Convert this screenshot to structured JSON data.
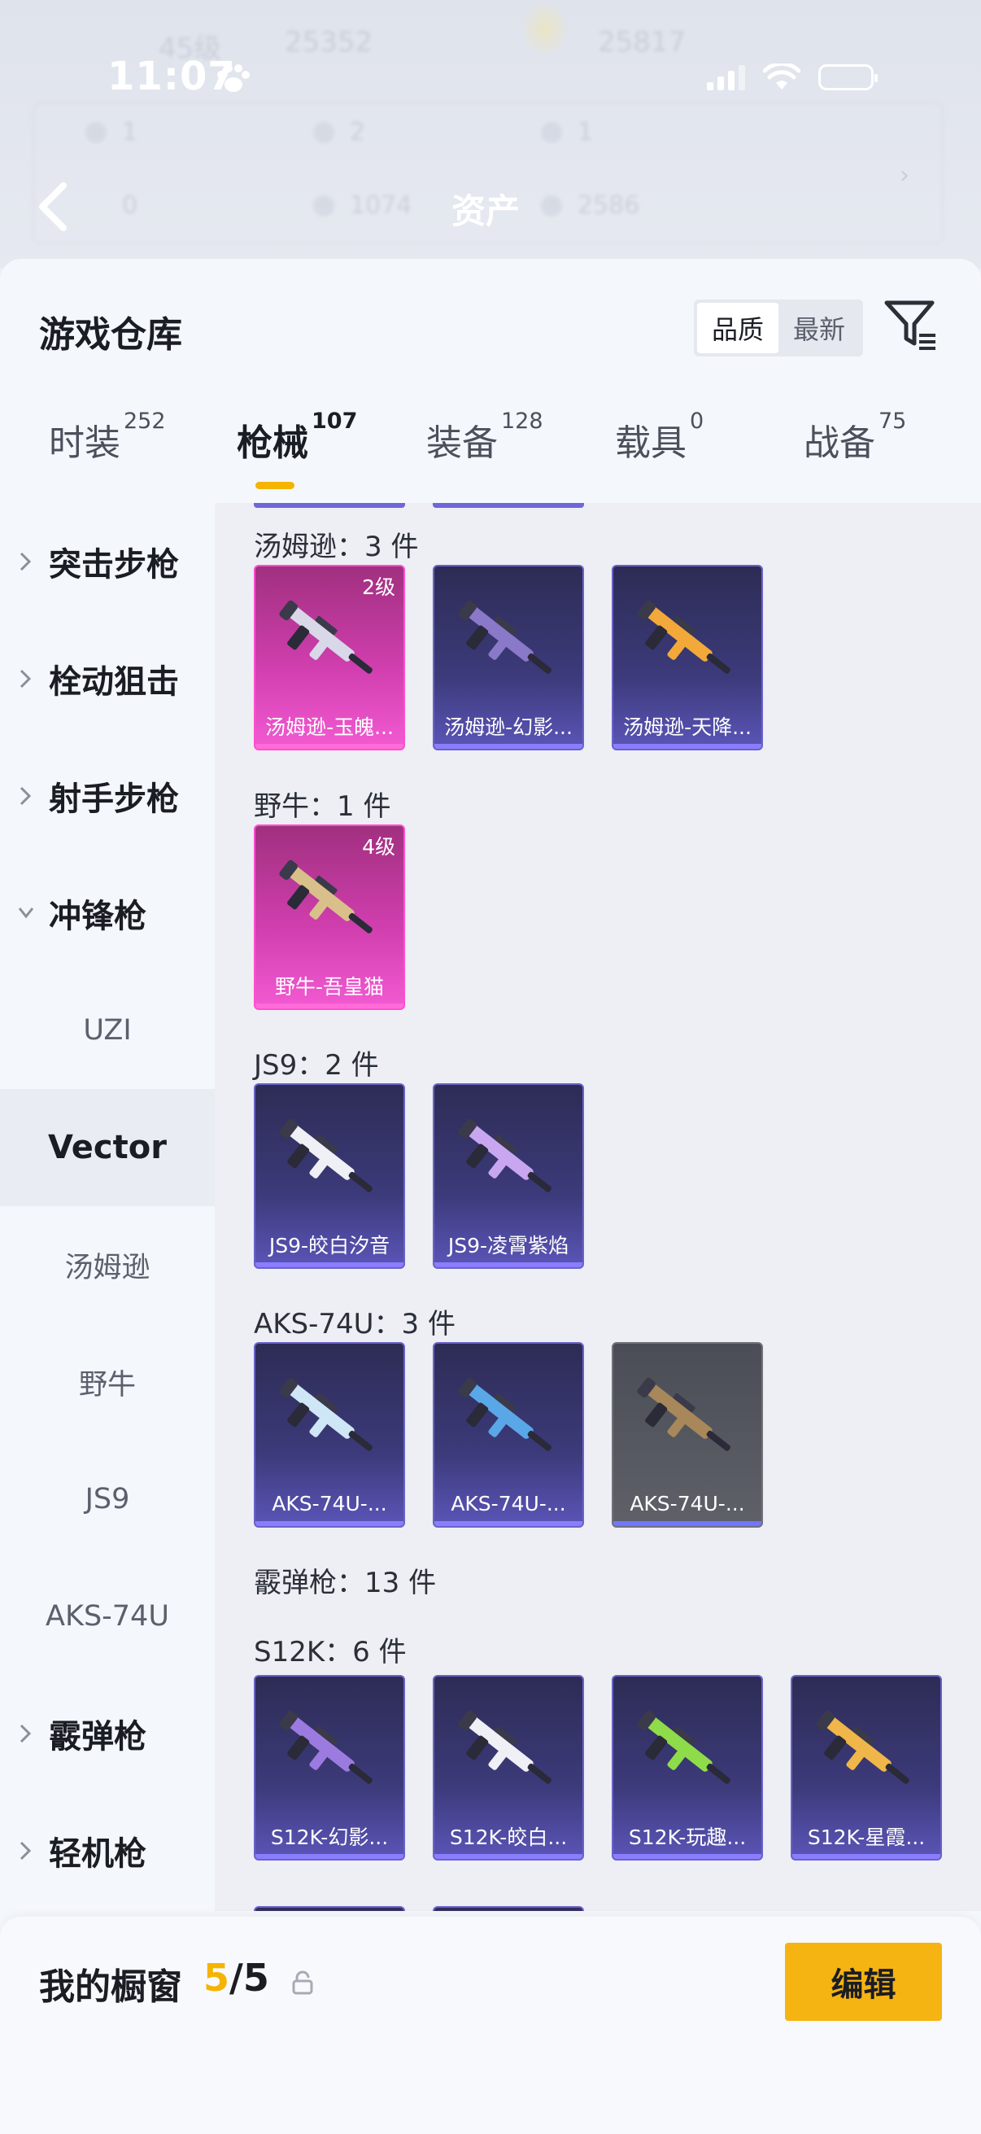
{
  "status_bar": {
    "time": "11:07"
  },
  "background": {
    "level_text": "45级",
    "coin_left": "25352",
    "coin_right": "25817",
    "row1": [
      "1",
      "2",
      "1"
    ],
    "row2": [
      "0",
      "1074",
      "2586"
    ],
    "title": "资产"
  },
  "sheet": {
    "title": "游戏仓库",
    "sort_options": [
      "品质",
      "最新"
    ],
    "active_sort": "品质"
  },
  "tabs": [
    {
      "label": "时装",
      "count": "252"
    },
    {
      "label": "枪械",
      "count": "107",
      "active": true
    },
    {
      "label": "装备",
      "count": "128"
    },
    {
      "label": "载具",
      "count": "0"
    },
    {
      "label": "战备",
      "count": "75"
    }
  ],
  "sidebar": [
    {
      "label": "突击步枪",
      "type": "category",
      "expanded": false
    },
    {
      "label": "栓动狙击",
      "type": "category",
      "expanded": false
    },
    {
      "label": "射手步枪",
      "type": "category",
      "expanded": false
    },
    {
      "label": "冲锋枪",
      "type": "category",
      "expanded": true
    },
    {
      "label": "UZI",
      "type": "sub"
    },
    {
      "label": "Vector",
      "type": "sub",
      "selected": true
    },
    {
      "label": "汤姆逊",
      "type": "sub"
    },
    {
      "label": "野牛",
      "type": "sub"
    },
    {
      "label": "JS9",
      "type": "sub"
    },
    {
      "label": "AKS-74U",
      "type": "sub"
    },
    {
      "label": "霰弹枪",
      "type": "category",
      "expanded": false
    },
    {
      "label": "轻机枪",
      "type": "category",
      "expanded": false
    }
  ],
  "groups": [
    {
      "title": "汤姆逊：3 件",
      "items": [
        {
          "name": "汤姆逊-玉魄...",
          "level": "2级",
          "rarity": "pink",
          "color": "#d8d8e8"
        },
        {
          "name": "汤姆逊-幻影...",
          "level": "",
          "rarity": "purple",
          "color": "#8a78c8"
        },
        {
          "name": "汤姆逊-天降...",
          "level": "",
          "rarity": "purple",
          "color": "#f2a93a"
        }
      ]
    },
    {
      "title": "野牛：1 件",
      "items": [
        {
          "name": "野牛-吾皇猫",
          "level": "4级",
          "rarity": "pink",
          "color": "#d9c08a"
        }
      ]
    },
    {
      "title": "JS9：2 件",
      "items": [
        {
          "name": "JS9-皎白汐音",
          "level": "",
          "rarity": "purple",
          "color": "#eef0f6"
        },
        {
          "name": "JS9-凌霄紫焰",
          "level": "",
          "rarity": "purple",
          "color": "#c8a7f0"
        }
      ]
    },
    {
      "title": "AKS-74U：3 件",
      "items": [
        {
          "name": "AKS-74U-...",
          "level": "",
          "rarity": "purple",
          "color": "#cfe6f7"
        },
        {
          "name": "AKS-74U-...",
          "level": "",
          "rarity": "purple",
          "color": "#5aa7e8"
        },
        {
          "name": "AKS-74U-...",
          "level": "",
          "rarity": "grey",
          "color": "#a8875a"
        }
      ]
    },
    {
      "title": "霰弹枪：13 件",
      "items": []
    },
    {
      "title": "S12K：6 件",
      "items": [
        {
          "name": "S12K-幻影...",
          "level": "",
          "rarity": "purple",
          "color": "#9c7be0"
        },
        {
          "name": "S12K-皎白...",
          "level": "",
          "rarity": "purple",
          "color": "#eef0f6"
        },
        {
          "name": "S12K-玩趣...",
          "level": "",
          "rarity": "purple",
          "color": "#8fdc4a"
        },
        {
          "name": "S12K-星霞...",
          "level": "",
          "rarity": "purple",
          "color": "#f0b64a"
        }
      ]
    }
  ],
  "bottom": {
    "label": "我的橱窗",
    "current": "5",
    "separator": "/5",
    "edit_label": "编辑"
  },
  "colors": {
    "accent": "#f6b412",
    "pink_rarity": "#d03eae",
    "purple_rarity": "#3c3a7a"
  }
}
